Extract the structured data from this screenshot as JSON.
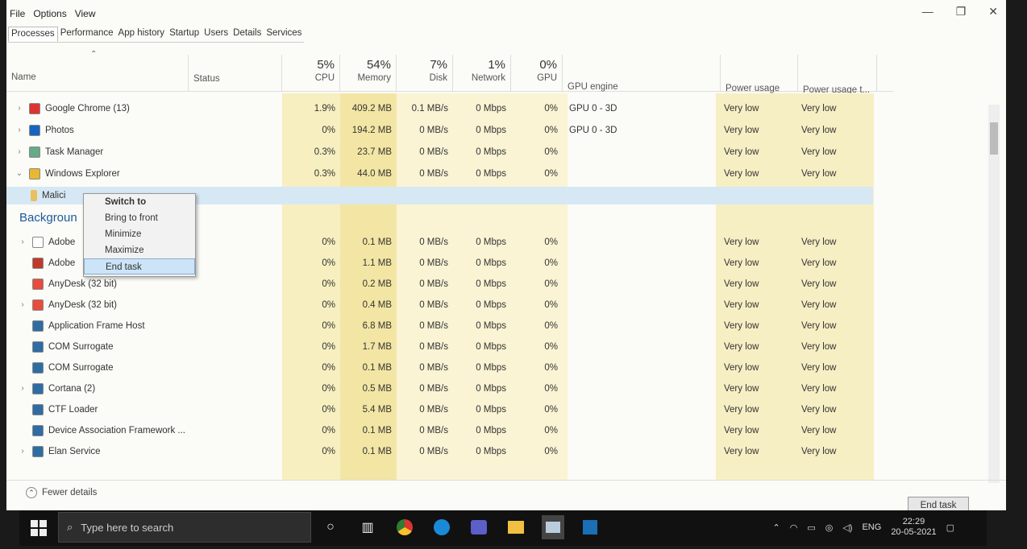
{
  "menu": [
    "File",
    "Options",
    "View"
  ],
  "window_controls": {
    "minimize": "—",
    "restore": "❐",
    "close": "✕"
  },
  "tabs": [
    "Processes",
    "Performance",
    "App history",
    "Startup",
    "Users",
    "Details",
    "Services"
  ],
  "header": {
    "name": "Name",
    "status": "Status",
    "cpu_pct": "5%",
    "cpu": "CPU",
    "mem_pct": "54%",
    "mem": "Memory",
    "disk_pct": "7%",
    "disk": "Disk",
    "net_pct": "1%",
    "net": "Network",
    "gpu_pct": "0%",
    "gpu": "GPU",
    "gpu_engine": "GPU engine",
    "power": "Power usage",
    "power_trend": "Power usage t..."
  },
  "apps": [
    {
      "name": "Google Chrome (13)",
      "icon": "chrome-icon",
      "color": "#d33",
      "cpu": "1.9%",
      "mem": "409.2 MB",
      "disk": "0.1 MB/s",
      "net": "0 Mbps",
      "gpu": "0%",
      "gpu_engine": "GPU 0 - 3D",
      "power": "Very low",
      "power_t": "Very low"
    },
    {
      "name": "Photos",
      "icon": "photos-icon",
      "color": "#1565c0",
      "cpu": "0%",
      "mem": "194.2 MB",
      "disk": "0 MB/s",
      "net": "0 Mbps",
      "gpu": "0%",
      "gpu_engine": "GPU 0 - 3D",
      "power": "Very low",
      "power_t": "Very low"
    },
    {
      "name": "Task Manager",
      "icon": "task-manager-icon",
      "color": "#6a8",
      "cpu": "0.3%",
      "mem": "23.7 MB",
      "disk": "0 MB/s",
      "net": "0 Mbps",
      "gpu": "0%",
      "gpu_engine": "",
      "power": "Very low",
      "power_t": "Very low"
    },
    {
      "name": "Windows Explorer",
      "icon": "folder-icon",
      "color": "#e8b830",
      "cpu": "0.3%",
      "mem": "44.0 MB",
      "disk": "0 MB/s",
      "net": "0 Mbps",
      "gpu": "0%",
      "gpu_engine": "",
      "power": "Very low",
      "power_t": "Very low"
    }
  ],
  "selected_child": "Malici",
  "context_menu": [
    "Switch to",
    "Bring to front",
    "Minimize",
    "Maximize",
    "End task"
  ],
  "section_label": "Backgroun",
  "background": [
    {
      "name": "Adobe",
      "icon": "window-icon",
      "color": "#fff",
      "cpu": "0%",
      "mem": "0.1 MB",
      "disk": "0 MB/s",
      "net": "0 Mbps",
      "gpu": "0%",
      "power": "Very low",
      "power_t": "Very low"
    },
    {
      "name": "Adobe",
      "icon": "adobe-icon",
      "color": "#c0392b",
      "cpu": "0%",
      "mem": "1.1 MB",
      "disk": "0 MB/s",
      "net": "0 Mbps",
      "gpu": "0%",
      "power": "Very low",
      "power_t": "Very low"
    },
    {
      "name": "AnyDesk (32 bit)",
      "icon": "anydesk-icon",
      "color": "#e74c3c",
      "cpu": "0%",
      "mem": "0.2 MB",
      "disk": "0 MB/s",
      "net": "0 Mbps",
      "gpu": "0%",
      "power": "Very low",
      "power_t": "Very low"
    },
    {
      "name": "AnyDesk (32 bit)",
      "icon": "anydesk-icon",
      "color": "#e74c3c",
      "cpu": "0%",
      "mem": "0.4 MB",
      "disk": "0 MB/s",
      "net": "0 Mbps",
      "gpu": "0%",
      "power": "Very low",
      "power_t": "Very low"
    },
    {
      "name": "Application Frame Host",
      "icon": "app-frame-icon",
      "color": "#2e6da4",
      "cpu": "0%",
      "mem": "6.8 MB",
      "disk": "0 MB/s",
      "net": "0 Mbps",
      "gpu": "0%",
      "power": "Very low",
      "power_t": "Very low"
    },
    {
      "name": "COM Surrogate",
      "icon": "com-icon",
      "color": "#2e6da4",
      "cpu": "0%",
      "mem": "1.7 MB",
      "disk": "0 MB/s",
      "net": "0 Mbps",
      "gpu": "0%",
      "power": "Very low",
      "power_t": "Very low"
    },
    {
      "name": "COM Surrogate",
      "icon": "com-icon",
      "color": "#2e6da4",
      "cpu": "0%",
      "mem": "0.1 MB",
      "disk": "0 MB/s",
      "net": "0 Mbps",
      "gpu": "0%",
      "power": "Very low",
      "power_t": "Very low"
    },
    {
      "name": "Cortana (2)",
      "icon": "cortana-icon",
      "color": "#2e6da4",
      "cpu": "0%",
      "mem": "0.5 MB",
      "disk": "0 MB/s",
      "net": "0 Mbps",
      "gpu": "0%",
      "power": "Very low",
      "power_t": "Very low"
    },
    {
      "name": "CTF Loader",
      "icon": "ctf-icon",
      "color": "#2e6da4",
      "cpu": "0%",
      "mem": "5.4 MB",
      "disk": "0 MB/s",
      "net": "0 Mbps",
      "gpu": "0%",
      "power": "Very low",
      "power_t": "Very low"
    },
    {
      "name": "Device Association Framework ...",
      "icon": "device-icon",
      "color": "#2e6da4",
      "cpu": "0%",
      "mem": "0.1 MB",
      "disk": "0 MB/s",
      "net": "0 Mbps",
      "gpu": "0%",
      "power": "Very low",
      "power_t": "Very low"
    },
    {
      "name": "Elan Service",
      "icon": "service-icon",
      "color": "#2e6da4",
      "cpu": "0%",
      "mem": "0.1 MB",
      "disk": "0 MB/s",
      "net": "0 Mbps",
      "gpu": "0%",
      "power": "Very low",
      "power_t": "Very low"
    }
  ],
  "footer": {
    "fewer_details": "Fewer details",
    "end_task": "End task"
  },
  "taskbar": {
    "search_placeholder": "Type here to search",
    "lang": "ENG",
    "time": "22:29",
    "date": "20-05-2021"
  }
}
